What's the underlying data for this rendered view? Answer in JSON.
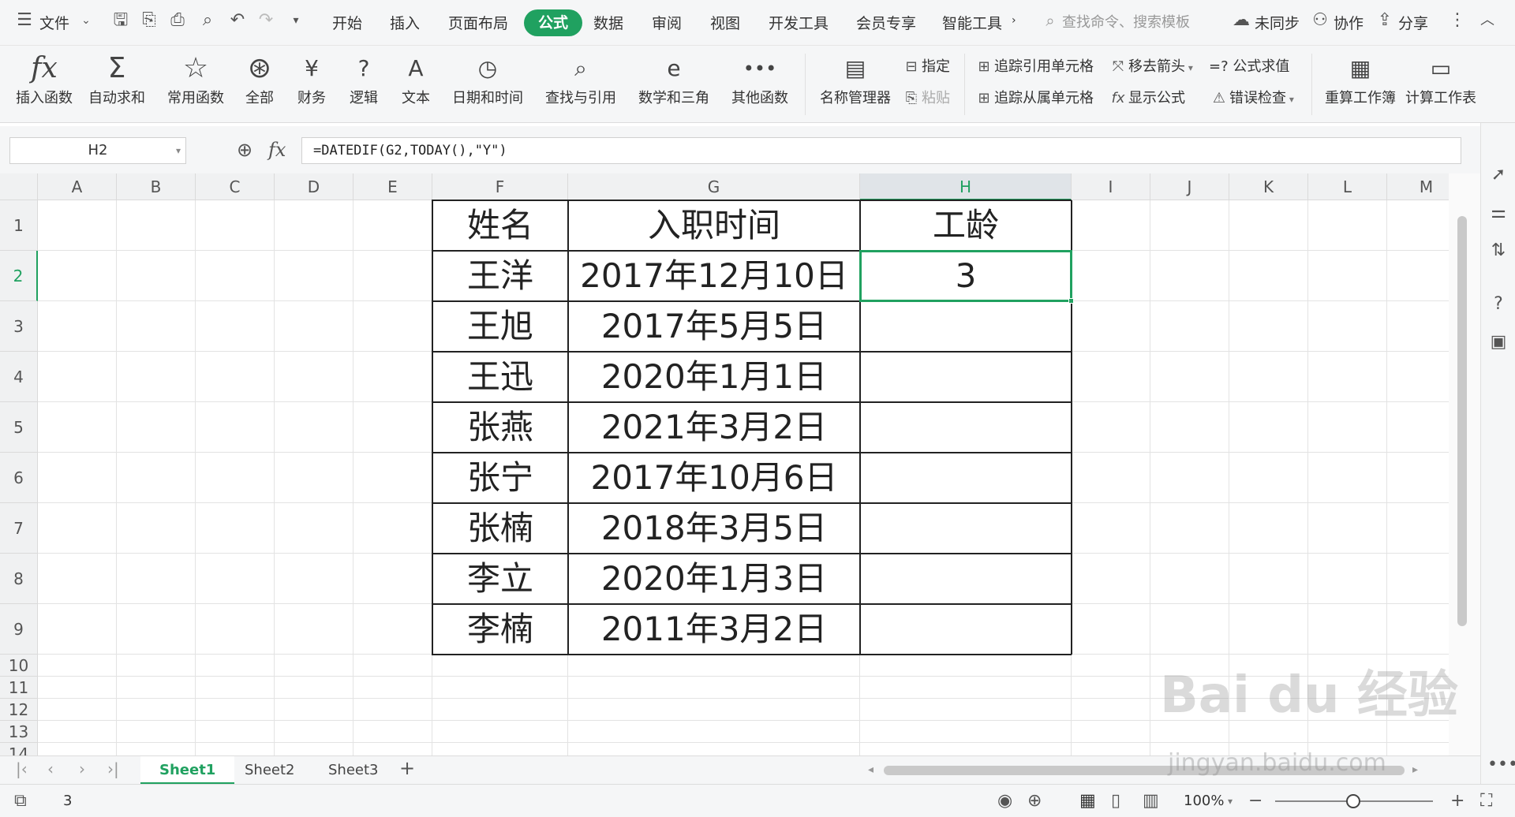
{
  "menubar": {
    "file_label": "文件",
    "tabs": [
      "开始",
      "插入",
      "页面布局",
      "公式",
      "数据",
      "审阅",
      "视图",
      "开发工具",
      "会员专享",
      "智能工具"
    ],
    "active_tab": "公式",
    "search_placeholder": "查找命令、搜索模板",
    "sync_label": "未同步",
    "collab_label": "协作",
    "share_label": "分享"
  },
  "ribbon": {
    "insert_function": "插入函数",
    "autosum": "自动求和",
    "common_functions": "常用函数",
    "all": "全部",
    "finance": "财务",
    "logic": "逻辑",
    "text": "文本",
    "datetime": "日期和时间",
    "lookup": "查找与引用",
    "math": "数学和三角",
    "other_functions": "其他函数",
    "name_manager": "名称管理器",
    "specify": "指定",
    "paste": "粘贴",
    "trace_precedents": "追踪引用单元格",
    "trace_dependents": "追踪从属单元格",
    "remove_arrows": "移去箭头",
    "show_formulas": "显示公式",
    "evaluate_formula": "=? 公式求值",
    "error_check": "错误检查",
    "recalc_workbook": "重算工作簿",
    "calc_sheet": "计算工作表"
  },
  "formula_bar": {
    "name_box": "H2",
    "fx": "fx",
    "formula": "=DATEDIF(G2,TODAY(),\"Y\")"
  },
  "grid": {
    "columns": [
      "A",
      "B",
      "C",
      "D",
      "E",
      "F",
      "G",
      "H",
      "I",
      "J",
      "K",
      "L",
      "M"
    ],
    "rows": [
      "1",
      "2",
      "3",
      "4",
      "5",
      "6",
      "7",
      "8",
      "9",
      "10",
      "11",
      "12",
      "13",
      "14"
    ],
    "selected_column": "H",
    "selected_row": "2",
    "table": {
      "headers": [
        "姓名",
        "入职时间",
        "工龄"
      ],
      "rows": [
        [
          "王洋",
          "2017年12月10日",
          "3"
        ],
        [
          "王旭",
          "2017年5月5日",
          ""
        ],
        [
          "王迅",
          "2020年1月1日",
          ""
        ],
        [
          "张燕",
          "2021年3月2日",
          ""
        ],
        [
          "张宁",
          "2017年10月6日",
          ""
        ],
        [
          "张楠",
          "2018年3月5日",
          ""
        ],
        [
          "李立",
          "2020年1月3日",
          ""
        ],
        [
          "李楠",
          "2011年3月2日",
          ""
        ]
      ]
    }
  },
  "sheets": {
    "tabs": [
      "Sheet1",
      "Sheet2",
      "Sheet3"
    ],
    "active": "Sheet1",
    "add_label": "+"
  },
  "statusbar": {
    "value": "3",
    "zoom": "100%"
  },
  "watermark": {
    "brand": "Bai du 经验",
    "url": "jingyan.baidu.com"
  }
}
